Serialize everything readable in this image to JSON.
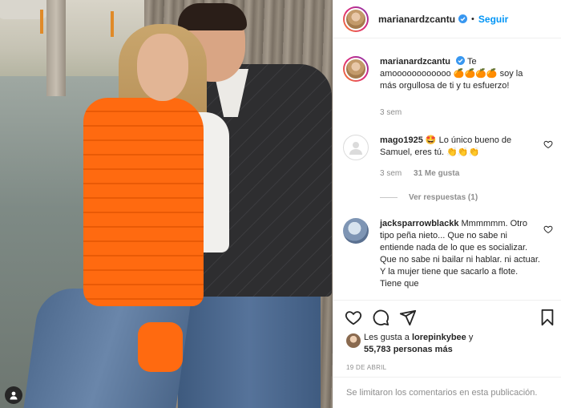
{
  "post_photo": {
    "description": "",
    "user_tag_icon": "user-tag-icon"
  },
  "header": {
    "username": "marianardzcantu",
    "verified_icon": "verified-badge-icon",
    "separator": "•",
    "follow_label": "Seguir"
  },
  "caption": {
    "username": "marianardzcantu",
    "text": "Te amoooooooooooo 🍊🍊🍊🍊 soy la más orgullosa de ti y tu esfuerzo!",
    "time": "3 sem"
  },
  "comments": [
    {
      "username": "mago1925",
      "text": "🤩 Lo único bueno de Samuel, eres tú. 👏👏👏",
      "time": "3 sem",
      "likes": "31 Me gusta",
      "view_replies": "Ver respuestas (1)"
    },
    {
      "username": "jacksparrowblackk",
      "text": "Mmmmmm. Otro tipo peña nieto... Que no sabe ni entiende nada de lo que es socializar. Que no sabe ni bailar ni hablar. ni actuar. Y la mujer tiene que sacarlo a flote. Tiene que"
    }
  ],
  "actions": {
    "like_icon": "heart-icon",
    "comment_icon": "comment-icon",
    "share_icon": "share-icon",
    "save_icon": "bookmark-icon"
  },
  "likes": {
    "prefix": "Les gusta a ",
    "first_user": "lorepinkybee",
    "middle": " y ",
    "count_text": "55,783 personas más"
  },
  "date": "19 DE ABRIL",
  "footer": {
    "comments_disabled": "Se limitaron los comentarios en esta publicación."
  },
  "colors": {
    "link_blue": "#0095f6",
    "muted_gray": "#8e8e8e",
    "text": "#262626"
  }
}
